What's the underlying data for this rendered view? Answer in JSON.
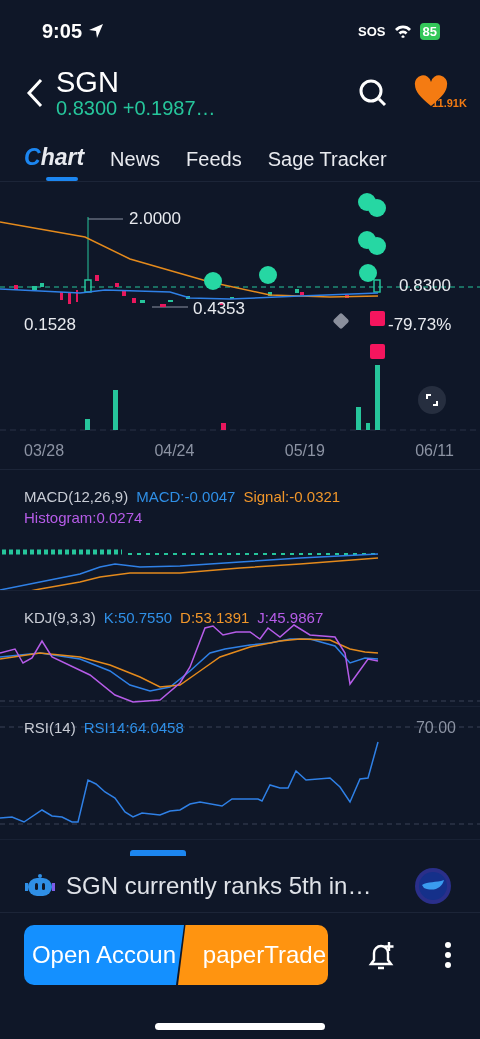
{
  "status_bar": {
    "time": "9:05",
    "carrier": "SOS",
    "battery": "85"
  },
  "header": {
    "symbol": "SGN",
    "quote": "0.8300 +0.1987…",
    "followers": "11.91K"
  },
  "tabs": [
    {
      "label": "Chart",
      "selected": true
    },
    {
      "label": "News",
      "selected": false
    },
    {
      "label": "Feeds",
      "selected": false
    },
    {
      "label": "Sage Tracker",
      "selected": false
    }
  ],
  "price_chart": {
    "high": "2.0000",
    "low": "0.4353",
    "left_low": "0.1528",
    "last": "0.8300",
    "change": "-79.73%",
    "dates": [
      "03/28",
      "04/24",
      "05/19",
      "06/11"
    ]
  },
  "indicators": [
    {
      "kind": "macd",
      "title": "MACD(12,26,9)",
      "values": [
        {
          "text": "MACD:-0.0047",
          "color": "#2f8fe6"
        },
        {
          "text": "Signal:-0.0321",
          "color": "#f0962a"
        },
        {
          "text": "Histogram:0.0274",
          "color": "#b65ce8"
        }
      ]
    },
    {
      "kind": "kdj",
      "title": "KDJ(9,3,3)",
      "values": [
        {
          "text": "K:50.7550",
          "color": "#2f8fe6"
        },
        {
          "text": "D:53.1391",
          "color": "#f0962a"
        },
        {
          "text": "J:45.9867",
          "color": "#b65ce8"
        }
      ]
    },
    {
      "kind": "rsi",
      "title": "RSI(14)",
      "level_label": "70.00",
      "values": [
        {
          "text": "RSI14:64.0458",
          "color": "#2f8fe6"
        }
      ]
    }
  ],
  "insight": {
    "text": "SGN currently ranks 5th in…"
  },
  "actions": {
    "open_account": "Open Accoun",
    "paper_trade": "paperTrade"
  }
}
